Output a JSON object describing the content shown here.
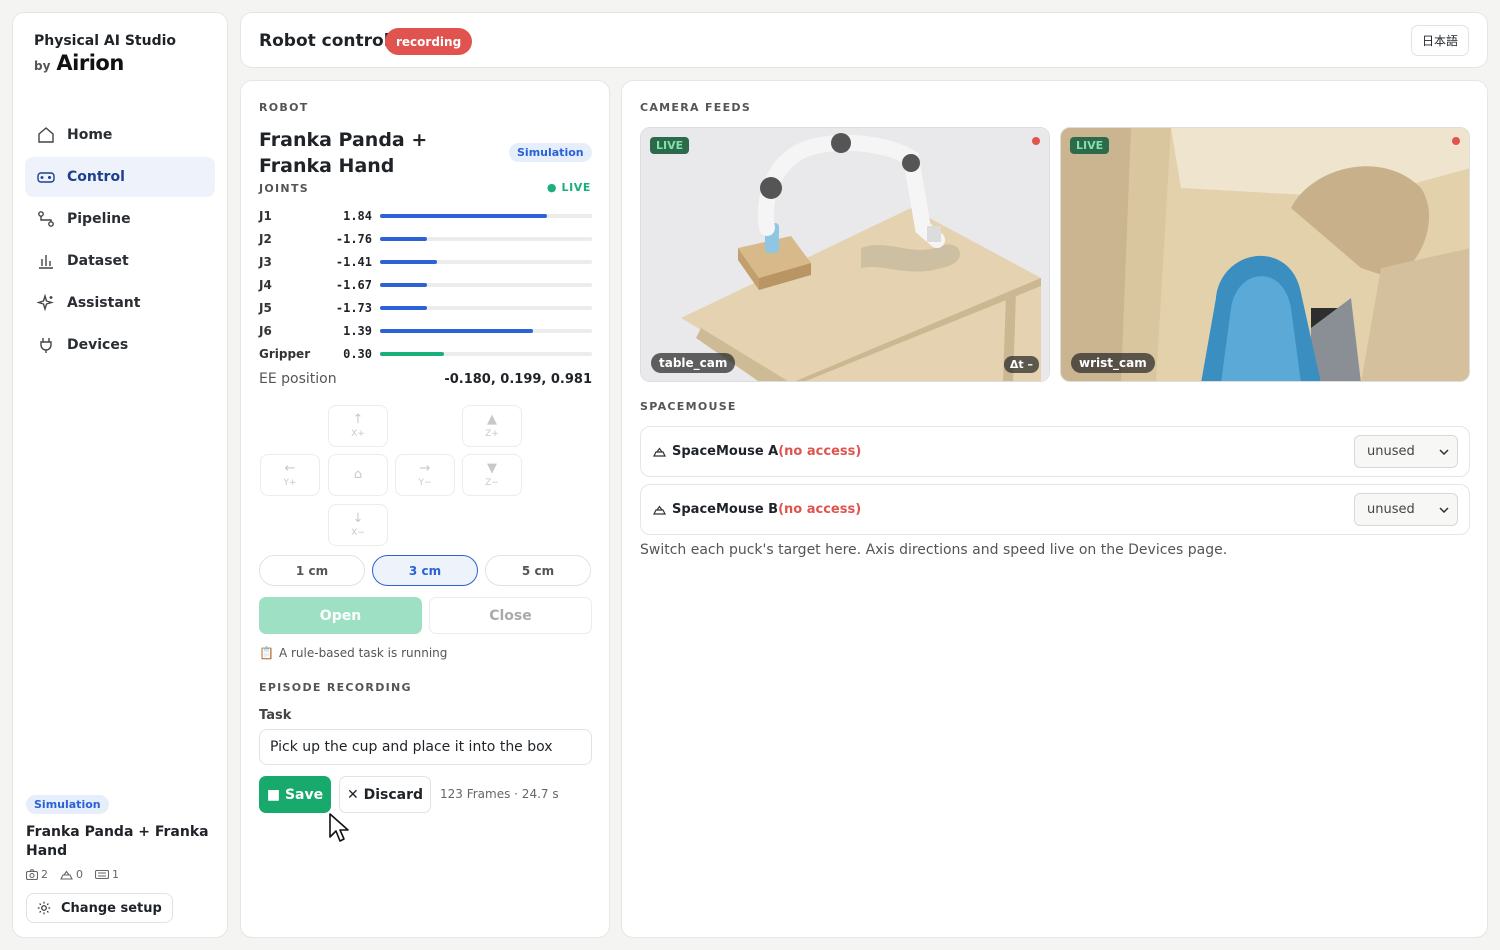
{
  "brand": {
    "title": "Physical AI Studio",
    "by": "by",
    "company": "Airion"
  },
  "nav": [
    {
      "label": "Home",
      "icon": "home-icon",
      "active": false
    },
    {
      "label": "Control",
      "icon": "gamepad-icon",
      "active": true
    },
    {
      "label": "Pipeline",
      "icon": "pipeline-icon",
      "active": false
    },
    {
      "label": "Dataset",
      "icon": "bar-chart-icon",
      "active": false
    },
    {
      "label": "Assistant",
      "icon": "sparkle-icon",
      "active": false
    },
    {
      "label": "Devices",
      "icon": "plug-icon",
      "active": false
    }
  ],
  "sidebar_footer": {
    "mode_badge": "Simulation",
    "robot_name": "Franka Panda + Franka Hand",
    "stats": {
      "cameras": "2",
      "spacemice": "0",
      "keyboards": "1"
    },
    "change_setup": "Change setup"
  },
  "header": {
    "title": "Robot control",
    "status_badge": "recording",
    "language": "日本語"
  },
  "robot": {
    "section": "ROBOT",
    "name": "Franka Panda + Franka Hand",
    "mode_badge": "Simulation",
    "joints_title": "JOINTS",
    "live": "● LIVE",
    "joints": [
      {
        "name": "J1",
        "value": "1.84",
        "level": 0.79
      },
      {
        "name": "J2",
        "value": "-1.76",
        "level": 0.22
      },
      {
        "name": "J3",
        "value": "-1.41",
        "level": 0.27
      },
      {
        "name": "J4",
        "value": "-1.67",
        "level": 0.22
      },
      {
        "name": "J5",
        "value": "-1.73",
        "level": 0.22
      },
      {
        "name": "J6",
        "value": "1.39",
        "level": 0.72
      },
      {
        "name": "Gripper",
        "value": "0.30",
        "level": 0.3,
        "gripper": true
      }
    ],
    "ee_label": "EE position",
    "ee_value": "-0.180, 0.199, 0.981",
    "jog": {
      "x_plus": {
        "arrow": "↑",
        "label": "X+"
      },
      "z_plus": {
        "arrow": "▲",
        "label": "Z+"
      },
      "y_plus": {
        "arrow": "←",
        "label": "Y+"
      },
      "home": {
        "arrow": "⌂",
        "label": ""
      },
      "y_minus": {
        "arrow": "→",
        "label": "Y−"
      },
      "z_minus": {
        "arrow": "▼",
        "label": "Z−"
      },
      "x_minus": {
        "arrow": "↓",
        "label": "X−"
      }
    },
    "steps": [
      "1 cm",
      "3 cm",
      "5 cm"
    ],
    "selected_step": "3 cm",
    "open_label": "Open",
    "close_label": "Close",
    "rule_note": "A rule-based task is running"
  },
  "episode": {
    "section": "EPISODE RECORDING",
    "task_label": "Task",
    "task_value": "Pick up the cup and place it into the box",
    "save_label": "■ Save",
    "discard_label": "✕ Discard",
    "frames": "123 Frames · 24.7 s"
  },
  "cameras": {
    "section": "CAMERA FEEDS",
    "feeds": [
      {
        "live": "LIVE",
        "name": "table_cam",
        "dt": "Δt –"
      },
      {
        "live": "LIVE",
        "name": "wrist_cam"
      }
    ]
  },
  "spacemouse": {
    "section": "SPACEMOUSE",
    "devices": [
      {
        "name": "SpaceMouse A",
        "status": "(no access)",
        "target": "unused"
      },
      {
        "name": "SpaceMouse B",
        "status": "(no access)",
        "target": "unused"
      }
    ],
    "note": "Switch each puck's target here. Axis directions and speed live on the Devices page."
  },
  "colors": {
    "accent": "#2c62d6",
    "success": "#18a96d",
    "danger": "#e0534f"
  }
}
